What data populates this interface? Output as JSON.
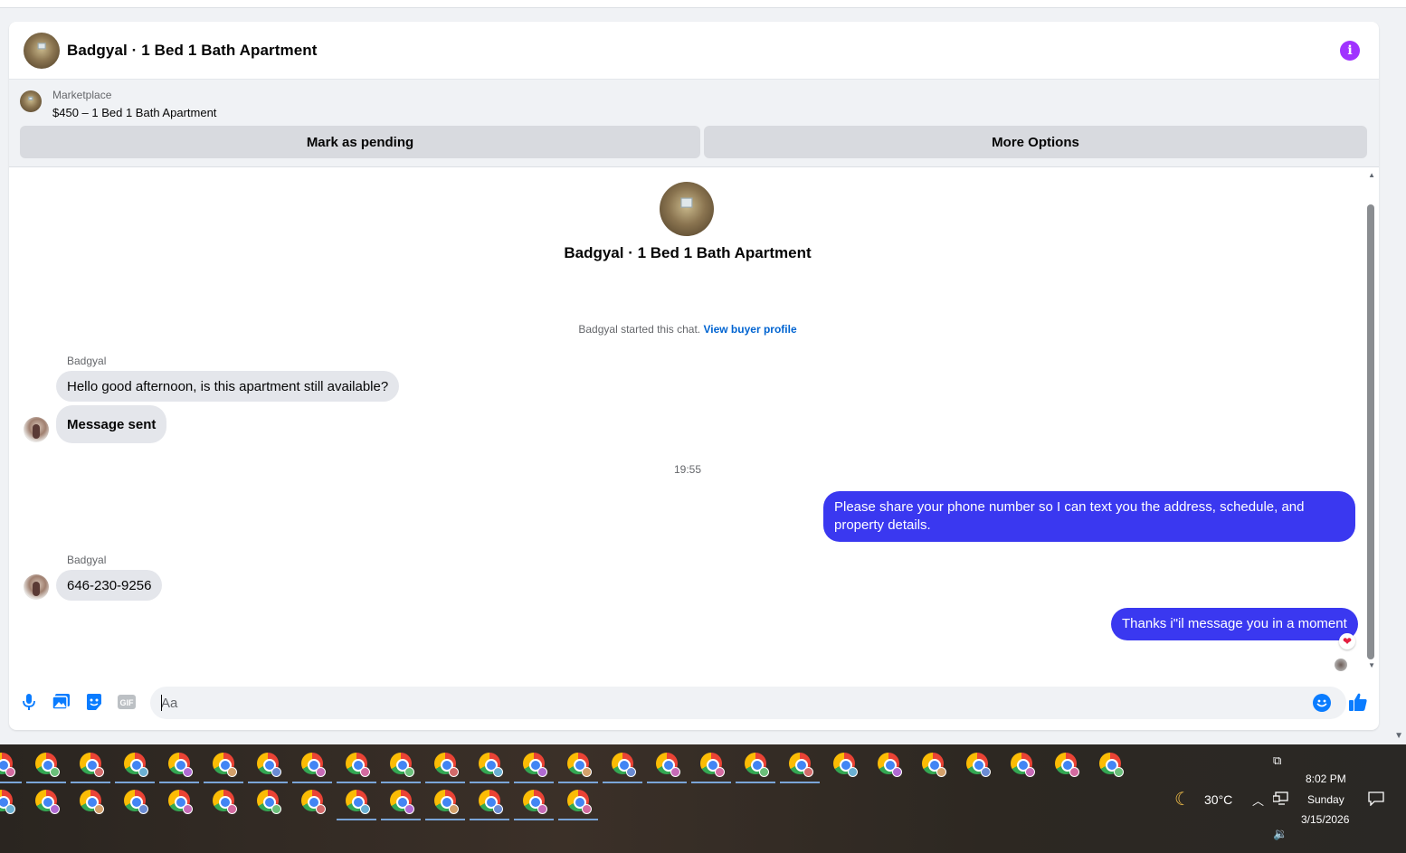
{
  "header": {
    "title": "Badgyal · 1 Bed 1 Bath Apartment",
    "info_icon": "info-icon"
  },
  "listing": {
    "source": "Marketplace",
    "title": "$450 – 1 Bed 1 Bath Apartment",
    "mark_pending_label": "Mark as pending",
    "more_options_label": "More Options"
  },
  "conversation": {
    "title": "Badgyal · 1 Bed 1 Bath Apartment",
    "started_text": "Badgyal started this chat.",
    "view_profile_label": "View buyer profile",
    "timestamp": "19:55",
    "messages": [
      {
        "sender": "Badgyal",
        "text": "Hello good afternoon, is this apartment still available?"
      },
      {
        "sender": "Badgyal",
        "text": "Message sent"
      },
      {
        "sender": "me",
        "text": "Please share your phone number so I can text you the address, schedule, and property details."
      },
      {
        "sender": "Badgyal",
        "text": "646-230-9256"
      },
      {
        "sender": "me",
        "text": "Thanks i\"il message you in a moment",
        "reaction": "❤"
      }
    ]
  },
  "composer": {
    "placeholder": "Aa",
    "icons": [
      "microphone-icon",
      "photo-icon",
      "sticker-icon",
      "gif-icon",
      "emoji-icon",
      "like-icon"
    ],
    "gif_label": "GIF"
  },
  "taskbar": {
    "weather_temp": "30°C",
    "time": "8:02 PM",
    "day": "Sunday",
    "date": "3/15/2026"
  },
  "colors": {
    "accent_blue": "#3a38f0",
    "messenger_blue": "#0a7cff",
    "info_purple": "#a033ff",
    "link_blue": "#0064d1"
  }
}
